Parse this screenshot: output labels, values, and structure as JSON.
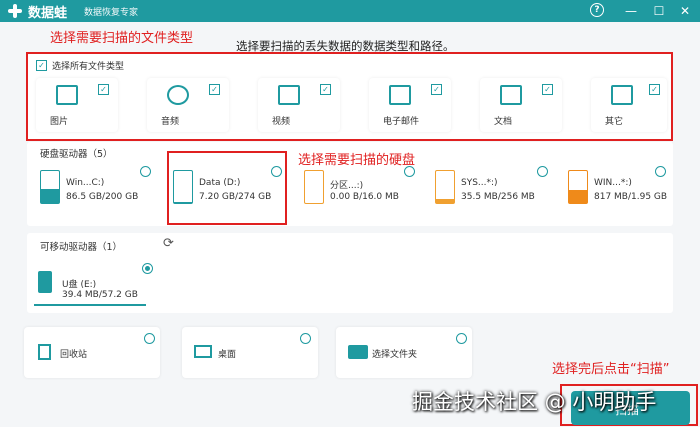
{
  "app": {
    "name": "数据蛙",
    "subtitle": "数据恢复专家"
  },
  "window_controls": {
    "help": "?",
    "minimize": "—",
    "maximize": "☐",
    "close": "✕"
  },
  "annotations": {
    "file_type": "选择需要扫描的文件类型",
    "disk": "选择需要扫描的硬盘",
    "scan": "选择完后点击“扫描”"
  },
  "instruction": "选择要扫描的丢失数据的数据类型和路径。",
  "file_types": {
    "select_all": "选择所有文件类型",
    "items": [
      {
        "label": "图片",
        "icon": "image-icon",
        "checked": true
      },
      {
        "label": "音频",
        "icon": "music-icon",
        "checked": true
      },
      {
        "label": "视频",
        "icon": "video-icon",
        "checked": true
      },
      {
        "label": "电子邮件",
        "icon": "mail-icon",
        "checked": true
      },
      {
        "label": "文档",
        "icon": "document-icon",
        "checked": true
      },
      {
        "label": "其它",
        "icon": "other-icon",
        "checked": true
      }
    ]
  },
  "hard_drives": {
    "title": "硬盘驱动器（5）",
    "items": [
      {
        "name": "Win...C:)",
        "size": "86.5 GB/200 GB",
        "fill": 0.43,
        "color": "#1f9aa0",
        "selected": false
      },
      {
        "name": "Data (D:)",
        "size": "7.20 GB/274 GB",
        "fill": 0.03,
        "color": "#1f9aa0",
        "selected": false
      },
      {
        "name": "分区...:)",
        "size": "0.00  B/16.0 MB",
        "fill": 0.0,
        "color": "#f0a030",
        "selected": false
      },
      {
        "name": "SYS...*:)",
        "size": "35.5 MB/256 MB",
        "fill": 0.14,
        "color": "#f0a030",
        "selected": false
      },
      {
        "name": "WIN...*:)",
        "size": "817 MB/1.95 GB",
        "fill": 0.42,
        "color": "#ef8a1a",
        "selected": false
      }
    ]
  },
  "removable": {
    "title": "可移动驱动器（1）",
    "items": [
      {
        "name": "U盘 (E:)",
        "size": "39.4 MB/57.2 GB",
        "selected": true
      }
    ]
  },
  "locations": [
    {
      "label": "回收站",
      "icon": "recycle-bin-icon"
    },
    {
      "label": "桌面",
      "icon": "desktop-icon"
    },
    {
      "label": "选择文件夹",
      "icon": "folder-icon"
    }
  ],
  "scan_button": {
    "label": "扫描"
  },
  "watermark": "掘金技术社区 @ 小明助手",
  "colors": {
    "accent": "#1f9aa0",
    "annotation": "#e02020",
    "warning": "#ef8a1a"
  }
}
